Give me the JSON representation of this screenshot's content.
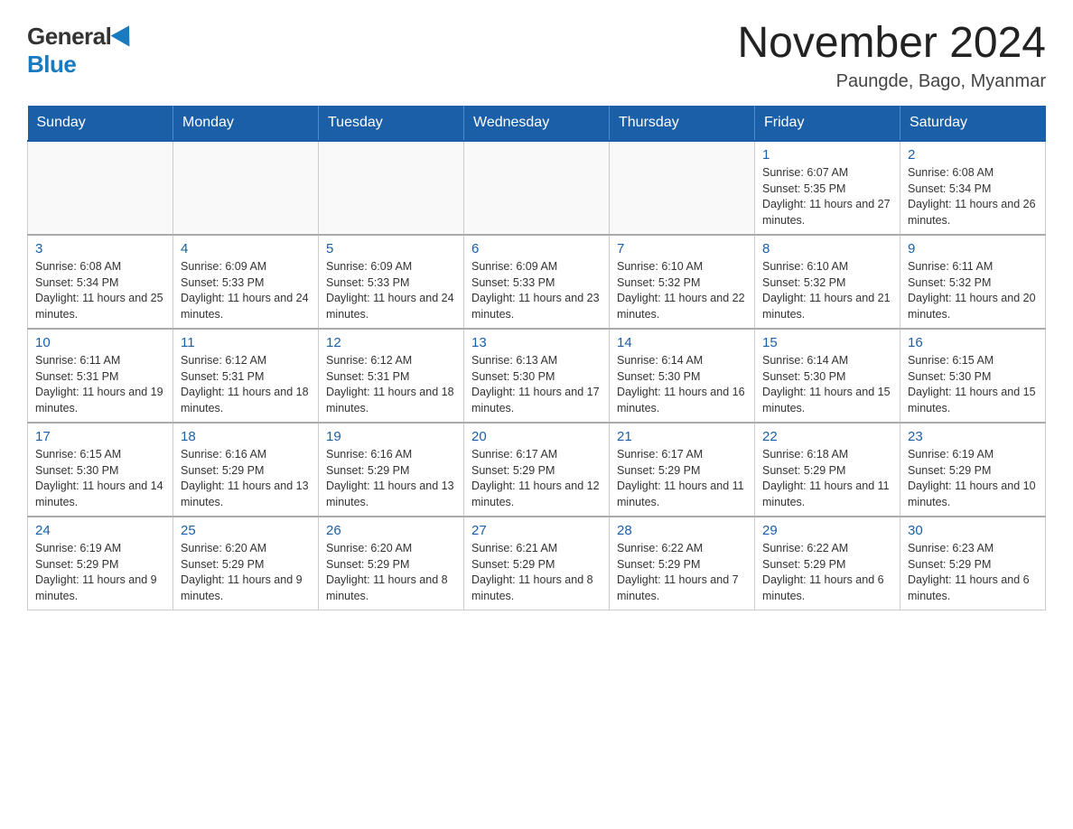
{
  "logo": {
    "general": "General",
    "blue": "Blue"
  },
  "title": "November 2024",
  "location": "Paungde, Bago, Myanmar",
  "days_of_week": [
    "Sunday",
    "Monday",
    "Tuesday",
    "Wednesday",
    "Thursday",
    "Friday",
    "Saturday"
  ],
  "weeks": [
    [
      {
        "day": "",
        "info": ""
      },
      {
        "day": "",
        "info": ""
      },
      {
        "day": "",
        "info": ""
      },
      {
        "day": "",
        "info": ""
      },
      {
        "day": "",
        "info": ""
      },
      {
        "day": "1",
        "info": "Sunrise: 6:07 AM\nSunset: 5:35 PM\nDaylight: 11 hours and 27 minutes."
      },
      {
        "day": "2",
        "info": "Sunrise: 6:08 AM\nSunset: 5:34 PM\nDaylight: 11 hours and 26 minutes."
      }
    ],
    [
      {
        "day": "3",
        "info": "Sunrise: 6:08 AM\nSunset: 5:34 PM\nDaylight: 11 hours and 25 minutes."
      },
      {
        "day": "4",
        "info": "Sunrise: 6:09 AM\nSunset: 5:33 PM\nDaylight: 11 hours and 24 minutes."
      },
      {
        "day": "5",
        "info": "Sunrise: 6:09 AM\nSunset: 5:33 PM\nDaylight: 11 hours and 24 minutes."
      },
      {
        "day": "6",
        "info": "Sunrise: 6:09 AM\nSunset: 5:33 PM\nDaylight: 11 hours and 23 minutes."
      },
      {
        "day": "7",
        "info": "Sunrise: 6:10 AM\nSunset: 5:32 PM\nDaylight: 11 hours and 22 minutes."
      },
      {
        "day": "8",
        "info": "Sunrise: 6:10 AM\nSunset: 5:32 PM\nDaylight: 11 hours and 21 minutes."
      },
      {
        "day": "9",
        "info": "Sunrise: 6:11 AM\nSunset: 5:32 PM\nDaylight: 11 hours and 20 minutes."
      }
    ],
    [
      {
        "day": "10",
        "info": "Sunrise: 6:11 AM\nSunset: 5:31 PM\nDaylight: 11 hours and 19 minutes."
      },
      {
        "day": "11",
        "info": "Sunrise: 6:12 AM\nSunset: 5:31 PM\nDaylight: 11 hours and 18 minutes."
      },
      {
        "day": "12",
        "info": "Sunrise: 6:12 AM\nSunset: 5:31 PM\nDaylight: 11 hours and 18 minutes."
      },
      {
        "day": "13",
        "info": "Sunrise: 6:13 AM\nSunset: 5:30 PM\nDaylight: 11 hours and 17 minutes."
      },
      {
        "day": "14",
        "info": "Sunrise: 6:14 AM\nSunset: 5:30 PM\nDaylight: 11 hours and 16 minutes."
      },
      {
        "day": "15",
        "info": "Sunrise: 6:14 AM\nSunset: 5:30 PM\nDaylight: 11 hours and 15 minutes."
      },
      {
        "day": "16",
        "info": "Sunrise: 6:15 AM\nSunset: 5:30 PM\nDaylight: 11 hours and 15 minutes."
      }
    ],
    [
      {
        "day": "17",
        "info": "Sunrise: 6:15 AM\nSunset: 5:30 PM\nDaylight: 11 hours and 14 minutes."
      },
      {
        "day": "18",
        "info": "Sunrise: 6:16 AM\nSunset: 5:29 PM\nDaylight: 11 hours and 13 minutes."
      },
      {
        "day": "19",
        "info": "Sunrise: 6:16 AM\nSunset: 5:29 PM\nDaylight: 11 hours and 13 minutes."
      },
      {
        "day": "20",
        "info": "Sunrise: 6:17 AM\nSunset: 5:29 PM\nDaylight: 11 hours and 12 minutes."
      },
      {
        "day": "21",
        "info": "Sunrise: 6:17 AM\nSunset: 5:29 PM\nDaylight: 11 hours and 11 minutes."
      },
      {
        "day": "22",
        "info": "Sunrise: 6:18 AM\nSunset: 5:29 PM\nDaylight: 11 hours and 11 minutes."
      },
      {
        "day": "23",
        "info": "Sunrise: 6:19 AM\nSunset: 5:29 PM\nDaylight: 11 hours and 10 minutes."
      }
    ],
    [
      {
        "day": "24",
        "info": "Sunrise: 6:19 AM\nSunset: 5:29 PM\nDaylight: 11 hours and 9 minutes."
      },
      {
        "day": "25",
        "info": "Sunrise: 6:20 AM\nSunset: 5:29 PM\nDaylight: 11 hours and 9 minutes."
      },
      {
        "day": "26",
        "info": "Sunrise: 6:20 AM\nSunset: 5:29 PM\nDaylight: 11 hours and 8 minutes."
      },
      {
        "day": "27",
        "info": "Sunrise: 6:21 AM\nSunset: 5:29 PM\nDaylight: 11 hours and 8 minutes."
      },
      {
        "day": "28",
        "info": "Sunrise: 6:22 AM\nSunset: 5:29 PM\nDaylight: 11 hours and 7 minutes."
      },
      {
        "day": "29",
        "info": "Sunrise: 6:22 AM\nSunset: 5:29 PM\nDaylight: 11 hours and 6 minutes."
      },
      {
        "day": "30",
        "info": "Sunrise: 6:23 AM\nSunset: 5:29 PM\nDaylight: 11 hours and 6 minutes."
      }
    ]
  ]
}
